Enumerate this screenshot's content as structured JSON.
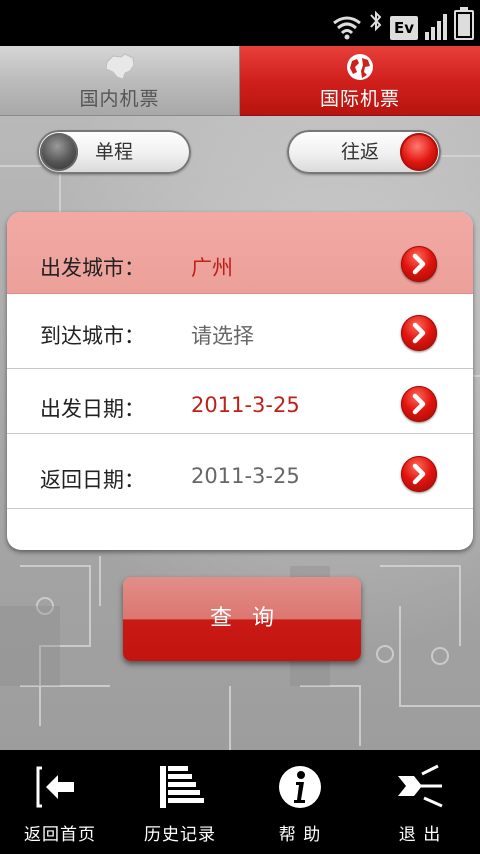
{
  "status_bar": {
    "ev_label": "Ev"
  },
  "tabs": {
    "domestic": "国内机票",
    "international": "国际机票"
  },
  "trip_type": {
    "single": "单程",
    "round": "往返",
    "selected": "round"
  },
  "form": {
    "depart_city_label": "出发城市：",
    "depart_city_value": "广州",
    "arrive_city_label": "到达城市：",
    "arrive_city_value": "请选择",
    "depart_date_label": "出发日期：",
    "depart_date_value": "2011-3-25",
    "return_date_label": "返回日期：",
    "return_date_value": "2011-3-25"
  },
  "search_button": "查询",
  "bottom_nav": {
    "home": "返回首页",
    "history": "历史记录",
    "help": "帮 助",
    "exit": "退 出"
  },
  "colors": {
    "accent": "#d0201c",
    "highlight_row": "#eca09a"
  }
}
